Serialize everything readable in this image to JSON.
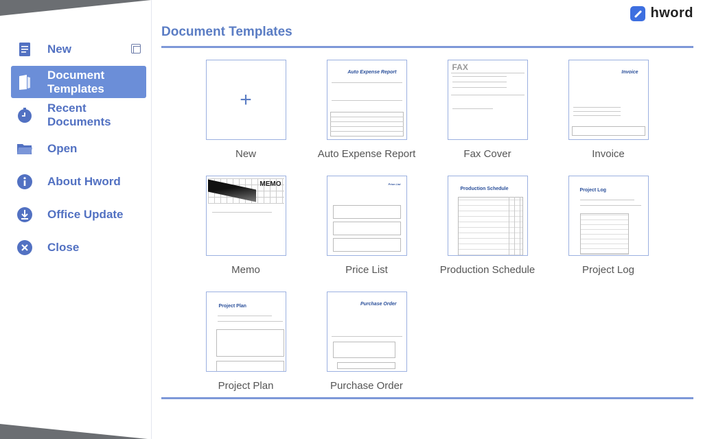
{
  "app": {
    "name": "hword"
  },
  "sidebar": {
    "items": [
      {
        "label": "New",
        "icon": "new-document-icon"
      },
      {
        "label": "Document\nTemplates",
        "icon": "document-templates-icon",
        "active": true
      },
      {
        "label": "Recent\nDocuments",
        "icon": "recent-clock-icon"
      },
      {
        "label": "Open",
        "icon": "folder-icon"
      },
      {
        "label": "About Hword",
        "icon": "info-icon"
      },
      {
        "label": "Office Update",
        "icon": "download-icon"
      },
      {
        "label": "Close",
        "icon": "close-icon"
      }
    ]
  },
  "main": {
    "title": "Document Templates",
    "templates": [
      {
        "label": "New"
      },
      {
        "label": "Auto Expense Report"
      },
      {
        "label": "Fax Cover"
      },
      {
        "label": "Invoice"
      },
      {
        "label": "Memo"
      },
      {
        "label": "Price List"
      },
      {
        "label": "Production Schedule"
      },
      {
        "label": "Project Log"
      },
      {
        "label": "Project Plan"
      },
      {
        "label": "Purchase Order"
      }
    ]
  },
  "thumbs": {
    "expense_title": "Auto Expense Report",
    "fax_title": "FAX",
    "invoice_title": "Invoice",
    "memo_title": "MEMO",
    "price_title": "Price List",
    "prodsched_title": "Production Schedule",
    "projlog_title": "Project Log",
    "projplan_title": "Project Plan",
    "po_title": "Purchase Order"
  },
  "colors": {
    "accent": "#5b7dc4",
    "active_bg": "#6b8ed8",
    "rule": "#7d98d8"
  }
}
